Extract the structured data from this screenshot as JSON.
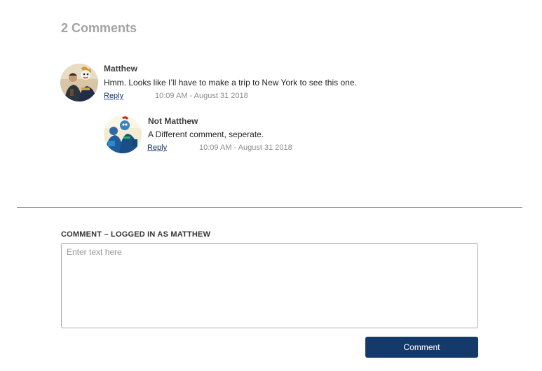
{
  "comments_section": {
    "heading": "2 Comments",
    "comments": [
      {
        "author": "Matthew",
        "body": "Hmm. Looks like I’ll have to make a trip to New York to see this one.",
        "reply_label": "Reply",
        "timestamp": "10:09 AM - August 31 2018",
        "avatar_icon": "user-avatar-icon"
      },
      {
        "author": "Not Matthew",
        "body": "A Different comment, seperate.",
        "reply_label": "Reply",
        "timestamp": "10:09 AM - August 31 2018",
        "avatar_icon": "user-avatar-icon"
      }
    ]
  },
  "comment_form": {
    "label": "COMMENT – LOGGED IN AS MATTHEW",
    "placeholder": "Enter text here",
    "value": "",
    "submit_label": "Comment"
  },
  "colors": {
    "button_bg": "#14396b",
    "link": "#17356a",
    "heading": "#a3a3a3"
  }
}
